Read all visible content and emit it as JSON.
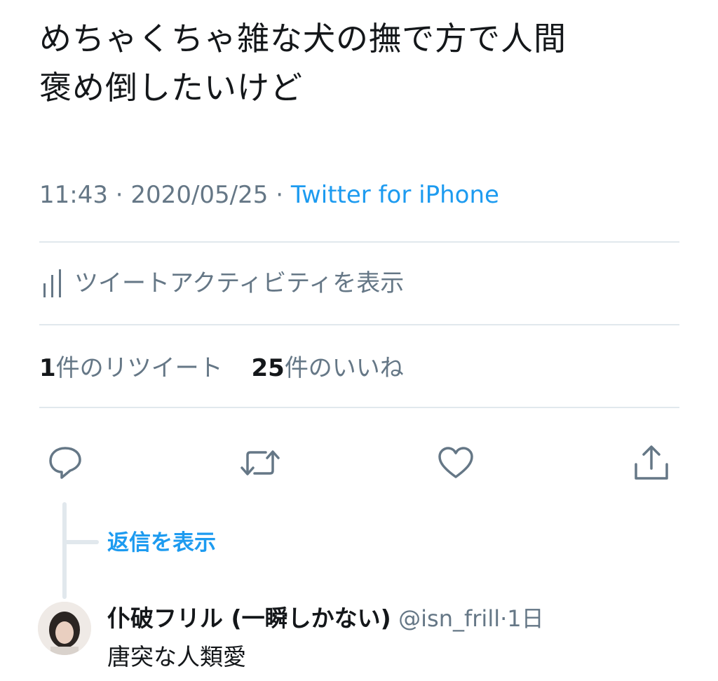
{
  "tweet": {
    "text_line1": "めちゃくちゃ雑な犬の撫で方で人間",
    "text_line2": "褒め倒したいけど",
    "time": "11:43",
    "date": "2020/05/25",
    "source": "Twitter for iPhone",
    "separator": " · "
  },
  "activity": {
    "label": "ツイートアクティビティを表示",
    "icon": "bar-chart-icon"
  },
  "stats": {
    "retweets_count": "1",
    "retweets_label": "件のリツイート",
    "likes_count": "25",
    "likes_label": "件のいいね"
  },
  "actions": {
    "icons": [
      "reply-icon",
      "retweet-icon",
      "like-icon",
      "share-icon"
    ]
  },
  "thread": {
    "show_replies_label": "返信を表示"
  },
  "reply": {
    "display_name": "仆破フリル (一瞬しかない)",
    "handle": "@isn_frill",
    "separator": "·",
    "time_ago": "1日",
    "text": "唐突な人類愛"
  },
  "colors": {
    "text_primary": "#14171a",
    "text_secondary": "#657786",
    "accent": "#1d9bf0",
    "divider": "#e1e8ed"
  }
}
